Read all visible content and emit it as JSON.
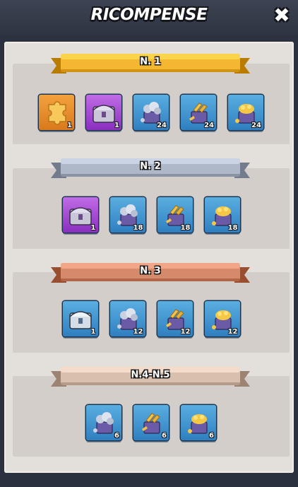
{
  "header": {
    "title": "RICOMPENSE",
    "close_label": "✖"
  },
  "sections": [
    {
      "label": "N. 1",
      "ribbon_color": "#f5b731",
      "items": [
        {
          "icon": "puzzle-piece-icon",
          "qty": "1",
          "bg": "orange"
        },
        {
          "icon": "purple-chest-icon",
          "qty": "1",
          "bg": "purple"
        },
        {
          "icon": "silver-ore-icon",
          "qty": "24",
          "bg": "blue"
        },
        {
          "icon": "gold-bars-icon",
          "qty": "24",
          "bg": "blue"
        },
        {
          "icon": "gold-coins-icon",
          "qty": "24",
          "bg": "blue"
        }
      ]
    },
    {
      "label": "N. 2",
      "ribbon_color": "#aeb8c8",
      "items": [
        {
          "icon": "purple-chest-icon",
          "qty": "1",
          "bg": "purple"
        },
        {
          "icon": "silver-ore-icon",
          "qty": "18",
          "bg": "blue"
        },
        {
          "icon": "gold-bars-icon",
          "qty": "18",
          "bg": "blue"
        },
        {
          "icon": "gold-coins-icon",
          "qty": "18",
          "bg": "blue"
        }
      ]
    },
    {
      "label": "N. 3",
      "ribbon_color": "#d58a6c",
      "items": [
        {
          "icon": "silver-chest-icon",
          "qty": "1",
          "bg": "blue"
        },
        {
          "icon": "silver-ore-icon",
          "qty": "12",
          "bg": "blue"
        },
        {
          "icon": "gold-bars-icon",
          "qty": "12",
          "bg": "blue"
        },
        {
          "icon": "gold-coins-icon",
          "qty": "12",
          "bg": "blue"
        }
      ]
    },
    {
      "label": "N.4-N.5",
      "ribbon_color": "#d9bfae",
      "items": [
        {
          "icon": "silver-ore-icon",
          "qty": "6",
          "bg": "blue"
        },
        {
          "icon": "gold-bars-icon",
          "qty": "6",
          "bg": "blue"
        },
        {
          "icon": "gold-coins-icon",
          "qty": "6",
          "bg": "blue"
        }
      ]
    }
  ]
}
